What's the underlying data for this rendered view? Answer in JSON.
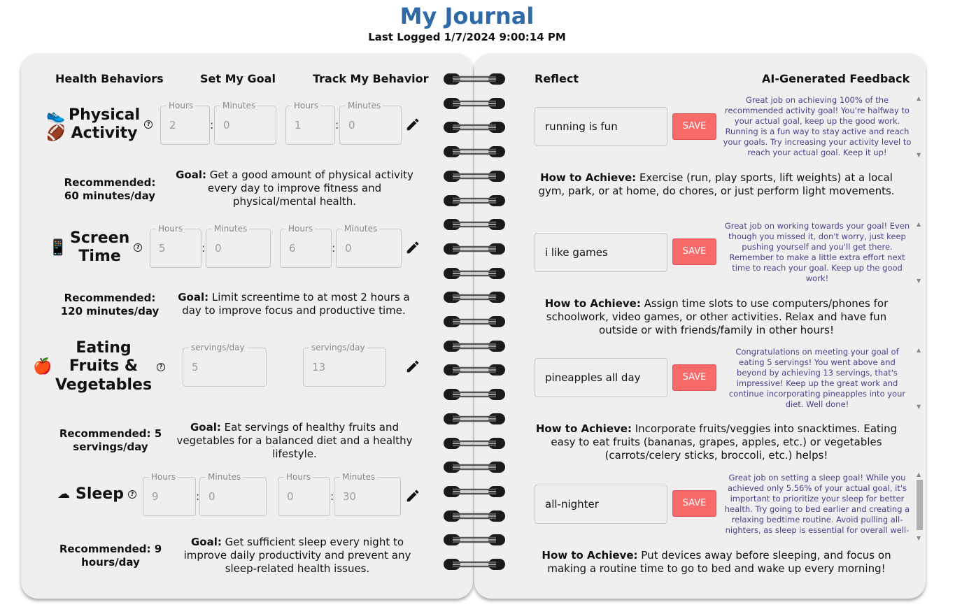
{
  "header": {
    "title": "My Journal",
    "last_logged": "Last Logged 1/7/2024 9:00:14 PM"
  },
  "columns": {
    "behaviors": "Health Behaviors",
    "goal": "Set My Goal",
    "track": "Track My Behavior",
    "reflect": "Reflect",
    "feedback": "AI-Generated Feedback"
  },
  "goal_prefix": "Goal:",
  "how_prefix": "How to Achieve:",
  "help_icon": "?",
  "save_label": "SAVE",
  "behaviors": [
    {
      "icons": [
        "running-shoe",
        "football"
      ],
      "name_l1": "Physical",
      "name_l2": "Activity",
      "recommended": "Recommended:",
      "recommended_2": "60 minutes/day",
      "goal_text": "Get a good amount of physical activity every day to improve fitness and physical/mental health.",
      "inputs": [
        {
          "label": "Hours",
          "value": "2"
        },
        {
          "label": "Minutes",
          "value": "0"
        },
        {
          "label": "Hours",
          "value": "1"
        },
        {
          "label": "Minutes",
          "value": "0"
        }
      ],
      "reflection": "running is fun",
      "feedback": "Great job on achieving 100% of the recommended activity goal! You're halfway to your actual goal, keep up the good work. Running is a fun way to stay active and reach your goals. Try increasing your activity level to reach your actual goal. Keep it up!",
      "how_text": "Exercise (run, play sports, lift weights) at a local gym, park, or at home, do chores, or just perform light movements."
    },
    {
      "icons": [
        "tablet"
      ],
      "name_l1": "Screen",
      "name_l2": "Time",
      "recommended": "Recommended:",
      "recommended_2": "120 minutes/day",
      "goal_text": "Limit screentime to at most 2 hours a day to improve focus and productive time.",
      "inputs": [
        {
          "label": "Hours",
          "value": "5"
        },
        {
          "label": "Minutes",
          "value": "0"
        },
        {
          "label": "Hours",
          "value": "6"
        },
        {
          "label": "Minutes",
          "value": "0"
        }
      ],
      "reflection": "i like games",
      "feedback": "Great job on working towards your goal! Even though you missed it, don't worry, just keep pushing yourself and you'll get there. Remember to make a little extra effort next time to reach your goal. Keep up the good work!",
      "how_text": "Assign time slots to use computers/phones for schoolwork, video games, or other activities. Relax and have fun outside or with friends/family in other hours!"
    },
    {
      "icons": [
        "apple"
      ],
      "name_l1": "Eating",
      "name_l2": "Fruits &",
      "name_l3": "Vegetables",
      "recommended": "Recommended: 5",
      "recommended_2": "servings/day",
      "goal_text": "Eat servings of healthy fruits and vegetables for a balanced diet and a healthy lifestyle.",
      "inputs": [
        {
          "label": "servings/day",
          "value": "5"
        },
        {
          "label": "servings/day",
          "value": "13"
        }
      ],
      "reflection": "pineapples all day",
      "feedback": "Congratulations on meeting your goal of eating 5 servings! You went above and beyond by achieving 13 servings, that's impressive! Keep up the great work and continue incorporating pineapples into your diet. Well done!",
      "how_text": "Incorporate fruits/veggies into snacktimes. Eating easy to eat fruits (bananas, grapes, apples, etc.) or vegetables (carrots/celery sticks, broccoli, etc.) helps!"
    },
    {
      "icons": [
        "pillow"
      ],
      "name_l1": "Sleep",
      "recommended": "Recommended: 9",
      "recommended_2": "hours/day",
      "goal_text": "Get sufficient sleep every night to improve daily productivity and prevent any sleep-related health issues.",
      "inputs": [
        {
          "label": "Hours",
          "value": "9"
        },
        {
          "label": "Minutes",
          "value": "0"
        },
        {
          "label": "Hours",
          "value": "0"
        },
        {
          "label": "Minutes",
          "value": "30"
        }
      ],
      "reflection": "all-nighter",
      "feedback": "Great job on setting a sleep goal! While you achieved only 5.56% of your actual goal, it's important to prioritize your sleep for better health. Try going to bed earlier and creating a relaxing bedtime routine. Avoid pulling all-nighters, as sleep is essential for overall well-being. Keep up the effort!",
      "how_text": "Put devices away before sleeping, and focus on making a routine time to go to bed and wake up every morning!"
    }
  ]
}
